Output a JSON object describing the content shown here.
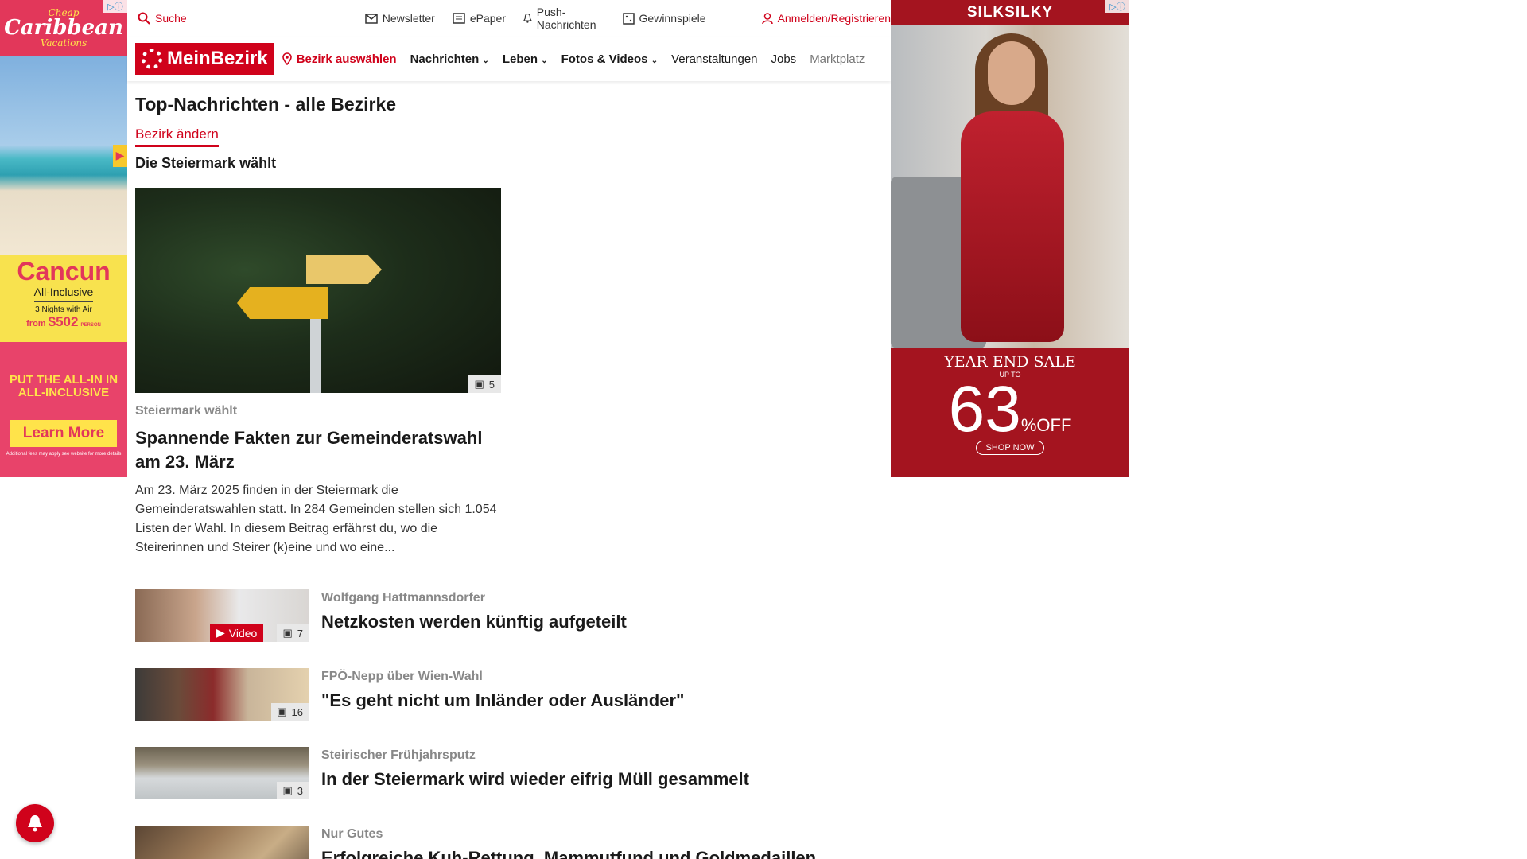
{
  "left_ad": {
    "brand_top": "Cheap",
    "brand_mid": "Caribbean",
    "brand_bottom": "Vacations",
    "destination": "Cancun",
    "package": "All-Inclusive",
    "nights": "3 Nights with Air",
    "price_prefix": "from",
    "price": "$502",
    "price_suffix": "PERSON",
    "slogan": "PUT THE ALL-IN IN ALL-INCLUSIVE",
    "cta": "Learn More",
    "fineprint": "Additional fees may apply see website for more details"
  },
  "right_ad": {
    "brand": "SILKSILKY",
    "sale_title": "YEAR END SALE",
    "up_to": "UP TO",
    "percent": "63",
    "percent_sign": "%",
    "off": "OFF",
    "cta": "SHOP NOW"
  },
  "topbar": {
    "search": "Suche",
    "newsletter": "Newsletter",
    "epaper": "ePaper",
    "push": "Push-Nachrichten",
    "gewinnspiele": "Gewinnspiele",
    "login": "Anmelden/Registrieren"
  },
  "nav": {
    "logo": "MeinBezirk",
    "select_district": "Bezirk auswählen",
    "items": [
      "Nachrichten",
      "Leben",
      "Fotos & Videos",
      "Veranstaltungen",
      "Jobs",
      "Marktplatz"
    ]
  },
  "page": {
    "title": "Top-Nachrichten - alle Bezirke",
    "change_district": "Bezirk ändern",
    "section": "Die Steiermark wählt"
  },
  "hero": {
    "image_count": "5",
    "kicker": "Steiermark wählt",
    "title": "Spannende Fakten zur Gemeinderatswahl am 23. März",
    "teaser": "Am 23. März 2025 finden in der Steiermark die Gemeinderatswahlen statt. In 284 Gemeinden stellen sich 1.054 Listen der Wahl. In diesem Beitrag erfährst du, wo die Steirerinnen und Steirer (k)eine und wo eine..."
  },
  "articles": [
    {
      "kicker": "Wolfgang Hattmannsdorfer",
      "title": "Netzkosten werden künftig aufgeteilt",
      "count": "7",
      "video": "Video"
    },
    {
      "kicker": "FPÖ-Nepp über Wien-Wahl",
      "title": "\"Es geht nicht um Inländer oder Ausländer\"",
      "count": "16"
    },
    {
      "kicker": "Steirischer Frühjahrsputz",
      "title": "In der Steiermark wird wieder eifrig Müll gesammelt",
      "count": "3"
    },
    {
      "kicker": "Nur Gutes",
      "title": "Erfolgreiche Kuh-Rettung, Mammutfund und Goldmedaillen",
      "count": ""
    }
  ]
}
